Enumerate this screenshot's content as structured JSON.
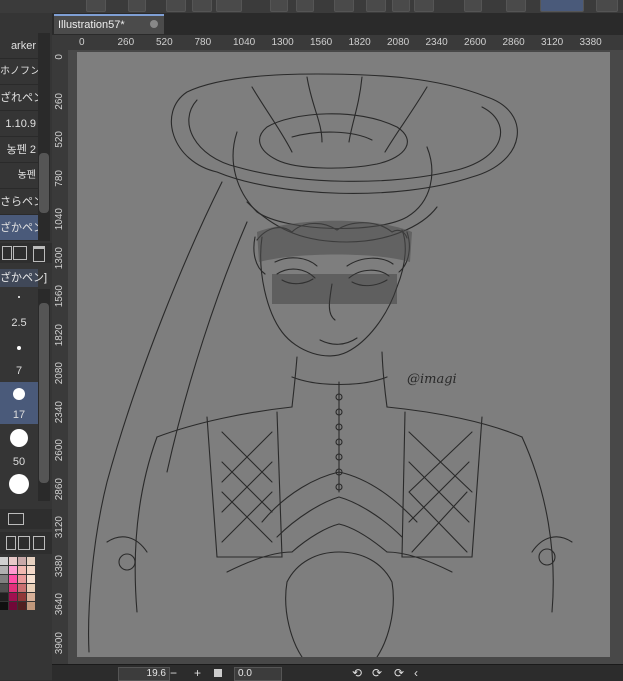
{
  "app": {
    "document_tab": {
      "title": "Illustration57*"
    }
  },
  "left_panel": {
    "brush_items": [
      {
        "label": "arker"
      },
      {
        "label": "ホノフン"
      },
      {
        "label": "ざれペン"
      },
      {
        "label": "1.10.9"
      },
      {
        "label": "농펜 2"
      },
      {
        "label": "농펜"
      },
      {
        "label": "さらペン"
      },
      {
        "label": "ざかペン",
        "selected": true
      }
    ],
    "active_brush_label": "ざかペン]",
    "brush_sizes": [
      {
        "label": "2.5"
      },
      {
        "label": "7"
      },
      {
        "label": "17",
        "selected": true
      },
      {
        "label": "50"
      }
    ]
  },
  "ruler": {
    "h_ticks": [
      "0",
      "260",
      "520",
      "780",
      "1040",
      "1300",
      "1560",
      "1820",
      "2080",
      "2340",
      "2600",
      "2860",
      "3120",
      "3380"
    ],
    "v_ticks": [
      "0",
      "260",
      "520",
      "780",
      "1040",
      "1300",
      "1560",
      "1820",
      "2080",
      "2340",
      "2600",
      "2860",
      "3120",
      "3380",
      "3640",
      "3900"
    ]
  },
  "canvas": {
    "signature": "@imagi"
  },
  "status_bar": {
    "zoom_value": "19.6",
    "rotation_value": "0.0"
  },
  "colors": {
    "canvas_bg": "#7e7e7e",
    "accent": "#4a5a7a",
    "tab_accent": "#7f9fd4"
  }
}
